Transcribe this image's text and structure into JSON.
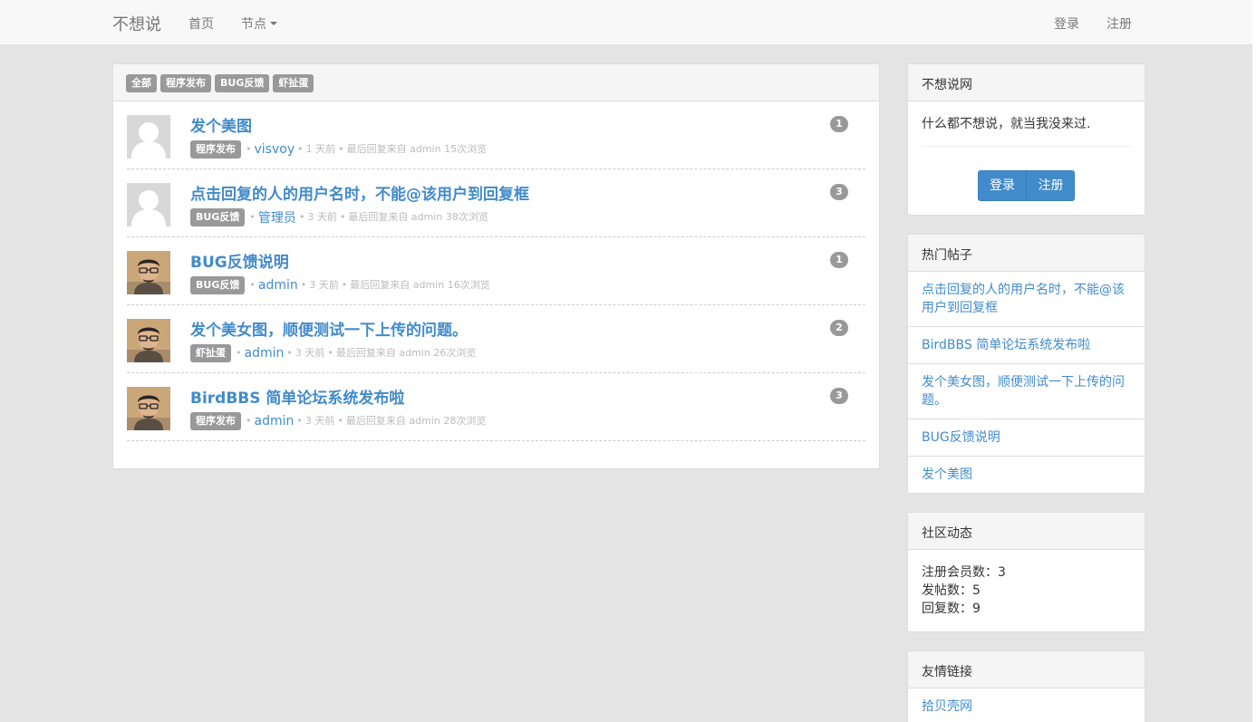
{
  "navbar": {
    "brand": "不想说",
    "home": "首页",
    "nodes": "节点",
    "login": "登录",
    "register": "注册"
  },
  "main": {
    "tabs": [
      "全部",
      "程序发布",
      "BUG反馈",
      "虾扯蛋"
    ],
    "posts": [
      {
        "title": "发个美图",
        "tag": "程序发布",
        "author": "visvoy",
        "time": "1 天前",
        "last_reply": "最后回复来自 admin",
        "views": "15次浏览",
        "count": "1",
        "avatar": "default-avatar"
      },
      {
        "title": "点击回复的人的用户名时，不能@该用户到回复框",
        "tag": "BUG反馈",
        "author": "管理员",
        "time": "3 天前",
        "last_reply": "最后回复来自 admin",
        "views": "38次浏览",
        "count": "3",
        "avatar": "default-avatar"
      },
      {
        "title": "BUG反馈说明",
        "tag": "BUG反馈",
        "author": "admin",
        "time": "3 天前",
        "last_reply": "最后回复来自 admin",
        "views": "16次浏览",
        "count": "1",
        "avatar": "user-photo"
      },
      {
        "title": "发个美女图，顺便测试一下上传的问题。",
        "tag": "虾扯蛋",
        "author": "admin",
        "time": "3 天前",
        "last_reply": "最后回复来自 admin",
        "views": "26次浏览",
        "count": "2",
        "avatar": "user-photo"
      },
      {
        "title": "BirdBBS 简单论坛系统发布啦",
        "tag": "程序发布",
        "author": "admin",
        "time": "3 天前",
        "last_reply": "最后回复来自 admin",
        "views": "28次浏览",
        "count": "3",
        "avatar": "user-photo"
      }
    ]
  },
  "sidebar": {
    "site": {
      "title": "不想说网",
      "description": "什么都不想说，就当我没来过.",
      "login": "登录",
      "register": "注册"
    },
    "hot": {
      "title": "热门帖子",
      "items": [
        "点击回复的人的用户名时，不能@该用户到回复框",
        "BirdBBS 简单论坛系统发布啦",
        "发个美女图，顺便测试一下上传的问题。",
        "BUG反馈说明",
        "发个美图"
      ]
    },
    "stats": {
      "title": "社区动态",
      "members_label": "注册会员数：",
      "members": "3",
      "posts_label": "发帖数：",
      "posts": "5",
      "replies_label": "回复数：",
      "replies": "9"
    },
    "links": {
      "title": "友情链接",
      "items": [
        "拾贝壳网"
      ]
    }
  },
  "colors": {
    "accent": "#428bca",
    "tag": "#999999",
    "background": "#e4e4e4"
  }
}
